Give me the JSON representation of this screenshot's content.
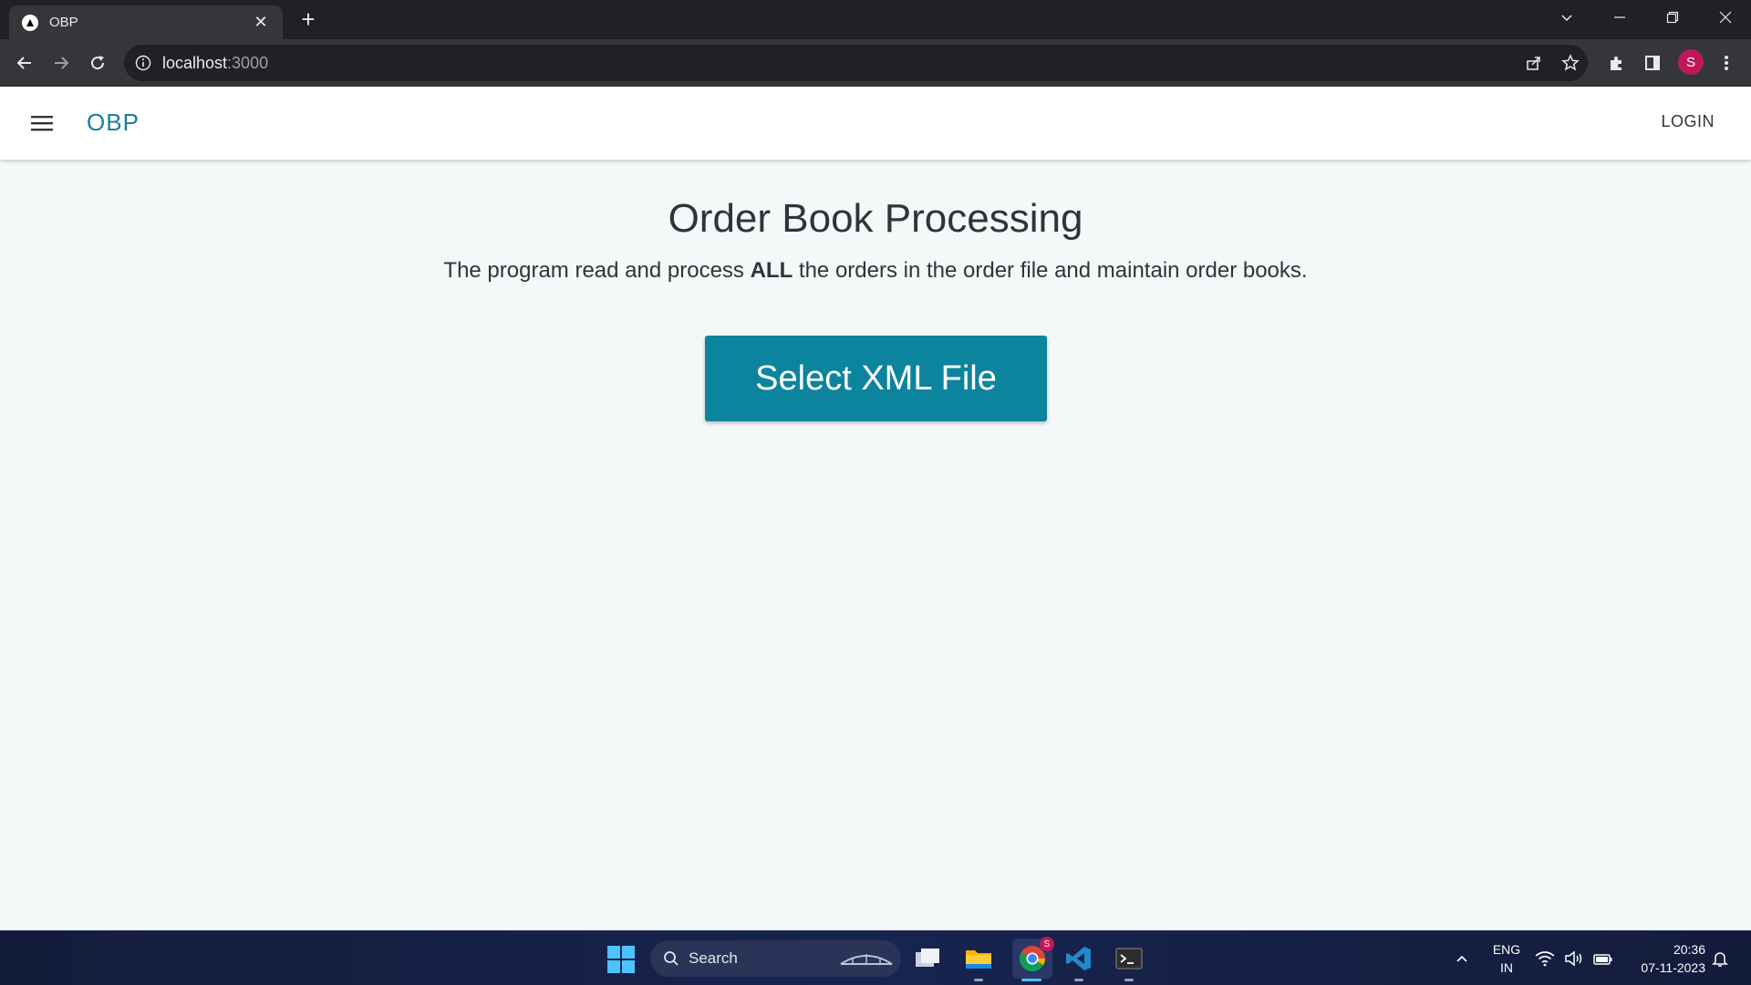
{
  "browser": {
    "tab_title": "OBP",
    "url_host": "localhost",
    "url_port": ":3000",
    "profile_initial": "S"
  },
  "appbar": {
    "brand": "OBP",
    "login_label": "LOGIN"
  },
  "main": {
    "title": "Order Book Processing",
    "subtitle_before": "The program read and process ",
    "subtitle_bold": "ALL",
    "subtitle_after": " the orders in the order file and maintain order books.",
    "select_button_label": "Select XML File"
  },
  "taskbar": {
    "search_label": "Search",
    "lang_line1": "ENG",
    "lang_line2": "IN",
    "time": "20:36",
    "date": "07-11-2023",
    "chrome_badge": "S"
  },
  "colors": {
    "brand": "#1a7f99",
    "button": "#0d849e",
    "page_bg": "#f5f8f9"
  }
}
